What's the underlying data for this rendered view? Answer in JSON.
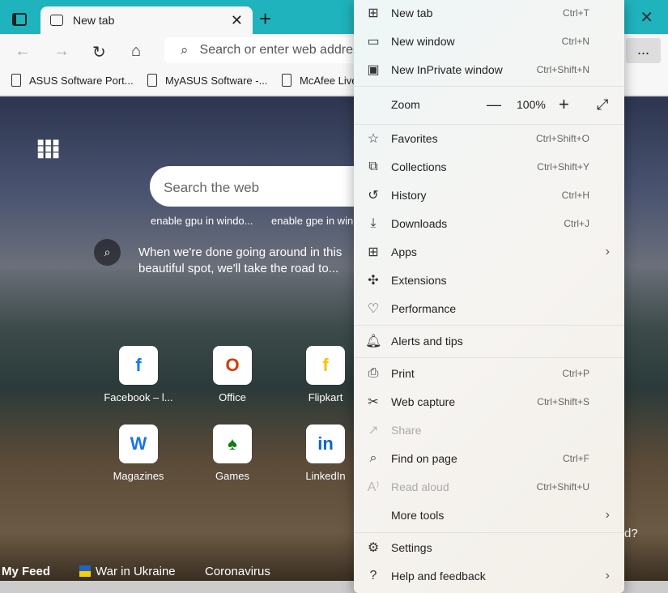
{
  "browser": {
    "tab_title": "New tab",
    "address_placeholder": "Search or enter web address",
    "bookmarks": [
      "ASUS Software Port...",
      "MyASUS Software -...",
      "McAfee Live"
    ],
    "more_label": "..."
  },
  "page": {
    "search_placeholder": "Search the web",
    "suggestions": [
      "enable gpu in windo...",
      "enable gpe in win"
    ],
    "caption": "When we're done going around in this beautiful spot, we'll take the road to...",
    "tiles": [
      {
        "label": "Facebook – l...",
        "glyph": "f"
      },
      {
        "label": "Office",
        "glyph": "O"
      },
      {
        "label": "Flipkart",
        "glyph": "f"
      },
      {
        "label": "Magazines",
        "glyph": "W"
      },
      {
        "label": "Games",
        "glyph": "♠"
      },
      {
        "label": "LinkedIn",
        "glyph": "in"
      }
    ],
    "feed": [
      "My Feed",
      "War in Ukraine",
      "Coronavirus"
    ],
    "partial_text": "d?"
  },
  "menu": {
    "items1": [
      {
        "label": "New tab",
        "shortcut": "Ctrl+T",
        "icon": "new-tab-icon",
        "g": "⊞"
      },
      {
        "label": "New window",
        "shortcut": "Ctrl+N",
        "icon": "new-window-icon",
        "g": "▭"
      },
      {
        "label": "New InPrivate window",
        "shortcut": "Ctrl+Shift+N",
        "icon": "inprivate-icon",
        "g": "▣"
      }
    ],
    "zoom": {
      "label": "Zoom",
      "value": "100%",
      "minus": "—",
      "plus": "+",
      "expand": "⤢"
    },
    "items2": [
      {
        "label": "Favorites",
        "shortcut": "Ctrl+Shift+O",
        "icon": "favorites-icon",
        "g": "☆"
      },
      {
        "label": "Collections",
        "shortcut": "Ctrl+Shift+Y",
        "icon": "collections-icon",
        "g": "⧉"
      },
      {
        "label": "History",
        "shortcut": "Ctrl+H",
        "icon": "history-icon",
        "g": "↺"
      },
      {
        "label": "Downloads",
        "shortcut": "Ctrl+J",
        "icon": "downloads-icon",
        "g": "⤓"
      },
      {
        "label": "Apps",
        "shortcut": "",
        "icon": "apps-icon",
        "g": "⊞",
        "sub": true
      },
      {
        "label": "Extensions",
        "shortcut": "",
        "icon": "extensions-icon",
        "g": "✣"
      },
      {
        "label": "Performance",
        "shortcut": "",
        "icon": "performance-icon",
        "g": "♡"
      }
    ],
    "alerts": {
      "label": "Alerts and tips",
      "g": "🔔︎"
    },
    "items3": [
      {
        "label": "Print",
        "shortcut": "Ctrl+P",
        "icon": "print-icon",
        "g": "⎙"
      },
      {
        "label": "Web capture",
        "shortcut": "Ctrl+Shift+S",
        "icon": "web-capture-icon",
        "g": "✂"
      },
      {
        "label": "Share",
        "shortcut": "",
        "icon": "share-icon",
        "g": "↗",
        "disabled": true
      },
      {
        "label": "Find on page",
        "shortcut": "Ctrl+F",
        "icon": "find-icon",
        "g": "⌕"
      },
      {
        "label": "Read aloud",
        "shortcut": "Ctrl+Shift+U",
        "icon": "read-aloud-icon",
        "g": "A⁾",
        "disabled": true
      },
      {
        "label": "More tools",
        "shortcut": "",
        "icon": "",
        "g": "",
        "sub": true
      }
    ],
    "items4": [
      {
        "label": "Settings",
        "shortcut": "",
        "icon": "settings-icon",
        "g": "⚙"
      },
      {
        "label": "Help and feedback",
        "shortcut": "",
        "icon": "help-icon",
        "g": "?",
        "sub": true
      }
    ]
  }
}
